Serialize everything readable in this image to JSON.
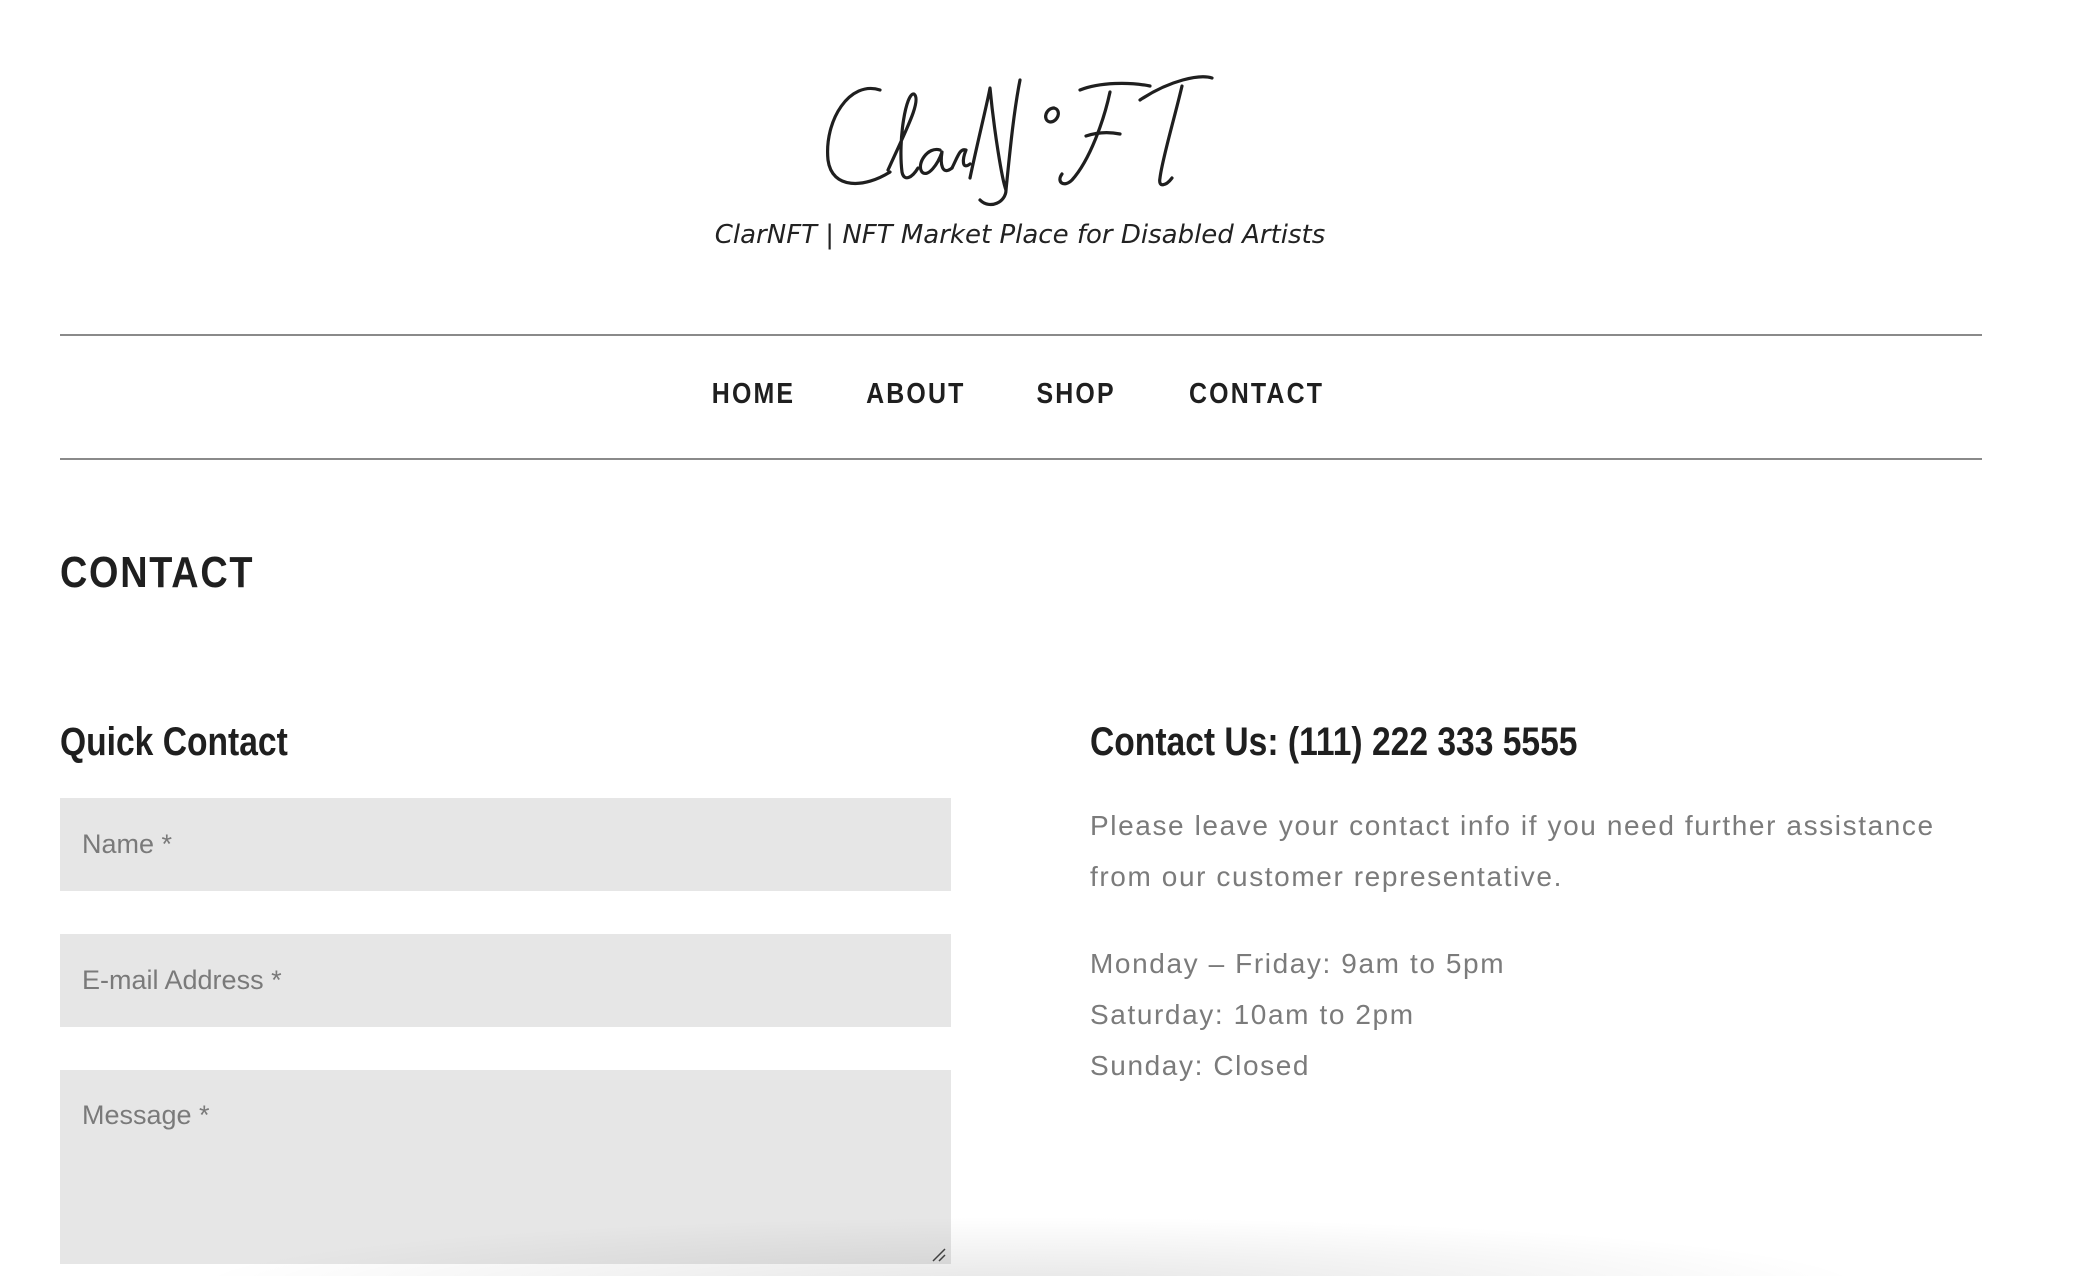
{
  "site": {
    "logo_text": "ClarNFT",
    "tagline": "ClarNFT | NFT Market Place for Disabled Artists"
  },
  "nav": {
    "items": [
      {
        "label": "HOME"
      },
      {
        "label": "ABOUT"
      },
      {
        "label": "SHOP"
      },
      {
        "label": "CONTACT"
      }
    ]
  },
  "page": {
    "title": "CONTACT"
  },
  "quick_contact": {
    "title": "Quick Contact",
    "name_placeholder": "Name *",
    "email_placeholder": "E-mail Address *",
    "message_placeholder": "Message *"
  },
  "contact_info": {
    "title": "Contact Us: (111) 222 333 5555",
    "description": "Please leave your contact info if you need further assistance from our customer representative.",
    "hours": [
      "Monday – Friday: 9am to 5pm",
      "Saturday: 10am to 2pm",
      "Sunday: Closed"
    ]
  }
}
